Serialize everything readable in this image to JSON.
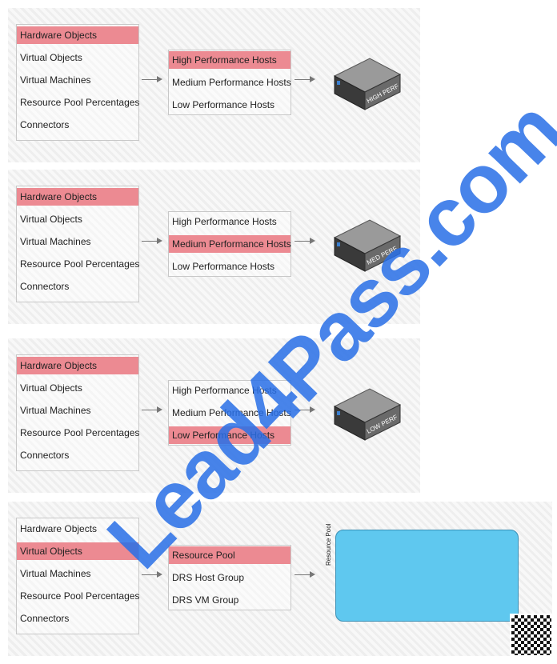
{
  "panels": [
    {
      "left": [
        "Hardware Objects",
        "Virtual Objects",
        "Virtual Machines",
        "Resource Pool Percentages",
        "Connectors"
      ],
      "left_selected": 0,
      "mid": [
        "High Performance Hosts",
        "Medium Performance Hosts",
        "Low Performance Hosts"
      ],
      "mid_selected": 0,
      "target": "server",
      "target_label": "HIGH PERF"
    },
    {
      "left": [
        "Hardware Objects",
        "Virtual Objects",
        "Virtual Machines",
        "Resource Pool Percentages",
        "Connectors"
      ],
      "left_selected": 0,
      "mid": [
        "High Performance Hosts",
        "Medium Performance Hosts",
        "Low Performance Hosts"
      ],
      "mid_selected": 1,
      "target": "server",
      "target_label": "MED PERF"
    },
    {
      "left": [
        "Hardware Objects",
        "Virtual Objects",
        "Virtual Machines",
        "Resource Pool Percentages",
        "Connectors"
      ],
      "left_selected": 0,
      "mid": [
        "High Performance Hosts",
        "Medium Performance Hosts",
        "Low Performance Hosts"
      ],
      "mid_selected": 2,
      "target": "server",
      "target_label": "LOW PERF"
    },
    {
      "left": [
        "Hardware Objects",
        "Virtual Objects",
        "Virtual Machines",
        "Resource Pool Percentages",
        "Connectors"
      ],
      "left_selected": 1,
      "mid": [
        "Resource Pool",
        "DRS Host Group",
        "DRS VM Group"
      ],
      "mid_selected": 0,
      "target": "pool",
      "target_label": "Resource Pool"
    }
  ],
  "colors": {
    "highlight": "#ec8a92",
    "pool": "#5fc8ef",
    "watermark": "#286ee6"
  },
  "watermark": "Lead4Pass.com"
}
